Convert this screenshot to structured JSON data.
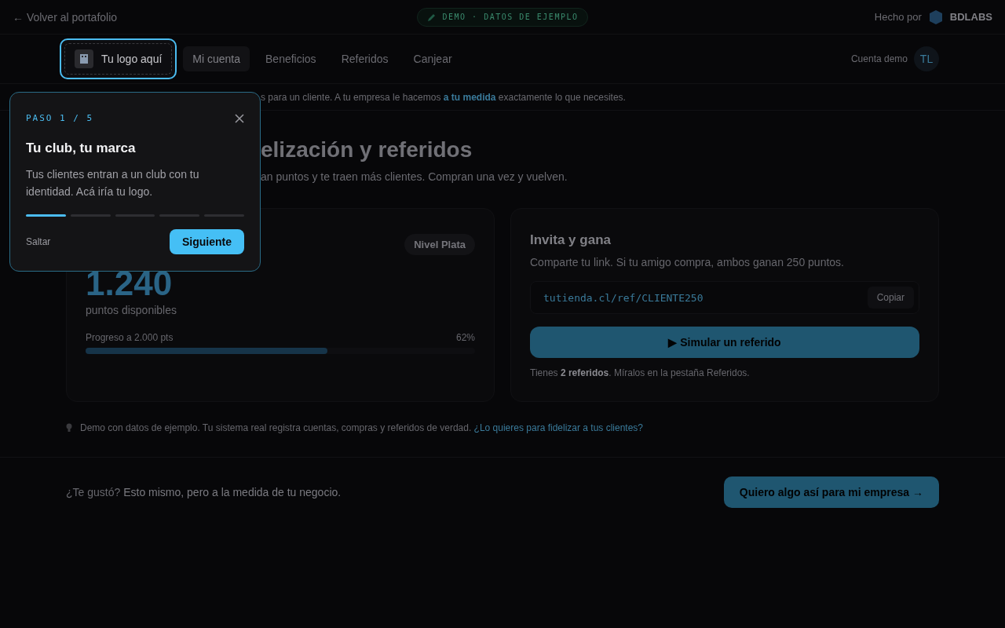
{
  "topbar": {
    "back_link": "← Volver al portafolio",
    "demo_badge": "DEMO · DATOS DE EJEMPLO",
    "made_by": "Hecho por",
    "brand": "BDLABS"
  },
  "nav": {
    "logo_placeholder": "Tu logo aquí",
    "highlighted": true,
    "tabs": [
      {
        "label": "Mi cuenta",
        "selected": true
      },
      {
        "label": "Beneficios",
        "selected": false
      },
      {
        "label": "Referidos",
        "selected": false
      },
      {
        "label": "Canjear",
        "selected": false
      }
    ],
    "account_label": "Cuenta demo",
    "avatar_initials": "TL"
  },
  "banner": "s para un cliente. A tu empresa le hacemos **a tu medida** exactamente lo que necesites.",
  "hero": {
    "title": "elización y referidos",
    "subtitle": "an puntos y te traen más clientes. Compran una vez y vuelven."
  },
  "points_card": {
    "tier": "Nivel Plata",
    "points": "1.240",
    "points_label": "puntos disponibles",
    "progress_label": "Progreso a 2.000 pts",
    "progress_percent": "62%",
    "level": 0.62
  },
  "referral_card": {
    "title": "Invita y gana",
    "description": "Comparte tu link. Si tu amigo compra, ambos ganan 250 puntos.",
    "link": "tutienda.cl/ref/CLIENTE250",
    "copy_button": "Copiar",
    "simulate_button": "▶ Simular un referido",
    "note": "Tienes **2 referidos**. Míralos en la pestaña Referidos."
  },
  "footnote": {
    "text": "Demo con datos de ejemplo. Tu sistema real registra cuentas, compras y referidos de verdad.",
    "link": "¿Lo quieres para fidelizar a tus clientes?"
  },
  "cta": {
    "lead": "¿Te gustó?",
    "text": "Esto mismo, pero a la medida de tu negocio.",
    "button": "Quiero algo así para mi empresa →"
  },
  "tour": {
    "step_label": "PASO 1 / 5",
    "title": "Tu club, tu marca",
    "body": "Tus clientes entran a un club con tu identidad. Acá iría tu logo.",
    "steps": [
      {
        "done": true
      },
      {
        "done": false
      },
      {
        "done": false
      },
      {
        "done": false
      },
      {
        "done": false
      }
    ],
    "skip": "Saltar",
    "next": "Siguiente"
  }
}
